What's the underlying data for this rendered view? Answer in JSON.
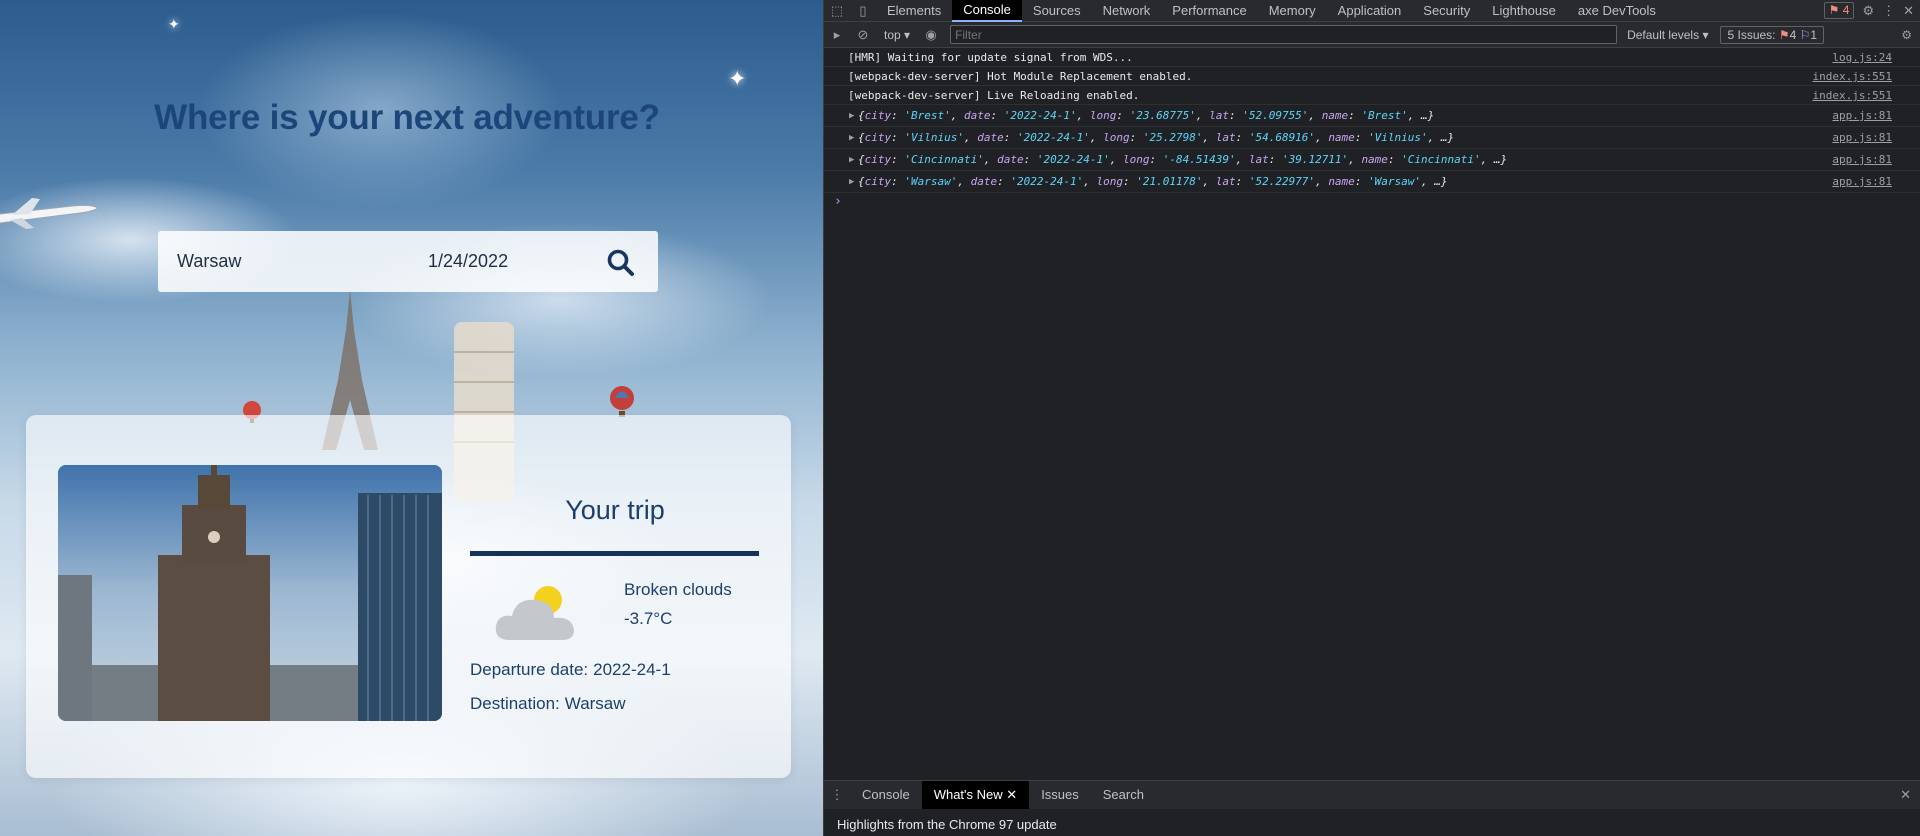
{
  "app": {
    "headline": "Where is your next adventure?",
    "search": {
      "city_value": "Warsaw",
      "date_value": "1/24/2022"
    },
    "trip": {
      "title": "Your trip",
      "weather_desc": "Broken clouds",
      "temperature": "-3.7°C",
      "departure_label": "Departure date:",
      "departure_value": "2022-24-1",
      "destination_label": "Destination:",
      "destination_value": "Warsaw"
    }
  },
  "devtools": {
    "tabs": [
      "Elements",
      "Console",
      "Sources",
      "Network",
      "Performance",
      "Memory",
      "Application",
      "Security",
      "Lighthouse",
      "axe DevTools"
    ],
    "active_tab": "Console",
    "error_count": "4",
    "toolbar": {
      "context": "top",
      "filter_placeholder": "Filter",
      "levels": "Default levels",
      "issues_label": "5 Issues:",
      "issues_errors": "4",
      "issues_info": "1"
    },
    "logs": [
      {
        "text": "[HMR] Waiting for update signal from WDS...",
        "source": "log.js:24"
      },
      {
        "text": "[webpack-dev-server] Hot Module Replacement enabled.",
        "source": "index.js:551"
      },
      {
        "text": "[webpack-dev-server] Live Reloading enabled.",
        "source": "index.js:551"
      }
    ],
    "objects": [
      {
        "city": "Brest",
        "date": "2022-24-1",
        "long": "23.68775",
        "lat": "52.09755",
        "name": "Brest",
        "source": "app.js:81"
      },
      {
        "city": "Vilnius",
        "date": "2022-24-1",
        "long": "25.2798",
        "lat": "54.68916",
        "name": "Vilnius",
        "source": "app.js:81"
      },
      {
        "city": "Cincinnati",
        "date": "2022-24-1",
        "long": "-84.51439",
        "lat": "39.12711",
        "name": "Cincinnati",
        "source": "app.js:81"
      },
      {
        "city": "Warsaw",
        "date": "2022-24-1",
        "long": "21.01178",
        "lat": "52.22977",
        "name": "Warsaw",
        "source": "app.js:81"
      }
    ],
    "drawer": {
      "tabs": [
        "Console",
        "What's New",
        "Issues",
        "Search"
      ],
      "active": "What's New",
      "highlight": "Highlights from the Chrome 97 update"
    }
  },
  "colors": {
    "heading": "#1c4679",
    "text": "#1c3f6e",
    "rule": "#17325a",
    "devtools_bg": "#202124"
  }
}
